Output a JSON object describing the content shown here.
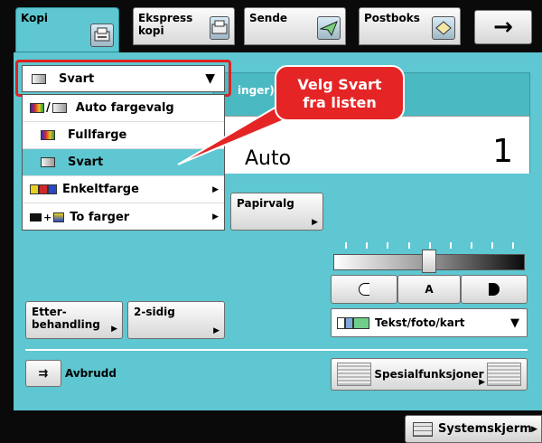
{
  "tabs": [
    {
      "label": "Kopi"
    },
    {
      "label": "Ekspress kopi"
    },
    {
      "label": "Sende"
    },
    {
      "label": "Postboks"
    }
  ],
  "tab_arrow": "→",
  "header": {
    "partial_text": "inger)"
  },
  "copy_area": {
    "mode": "Auto",
    "count": "1"
  },
  "color_dropdown": {
    "selected": "Svart",
    "options": [
      {
        "label": "Auto fargevalg"
      },
      {
        "label": "Fullfarge"
      },
      {
        "label": "Svart"
      },
      {
        "label": "Enkeltfarge"
      },
      {
        "label": "To farger"
      }
    ]
  },
  "callout": {
    "line1": "Velg Svart",
    "line2": "fra listen"
  },
  "buttons": {
    "paper": "Papirvalg",
    "finishing_line1": "Etter-",
    "finishing_line2": "behandling",
    "duplex": "2-sidig",
    "interrupt": "Avbrudd",
    "special": "Spesialfunksjoner",
    "system": "Systemskjerm"
  },
  "density": {
    "auto_label": "A",
    "level": 0.5
  },
  "original_type": {
    "selected": "Tekst/foto/kart"
  },
  "accent_colors": {
    "cyan": "#5ec7d1",
    "red": "#e52525"
  }
}
